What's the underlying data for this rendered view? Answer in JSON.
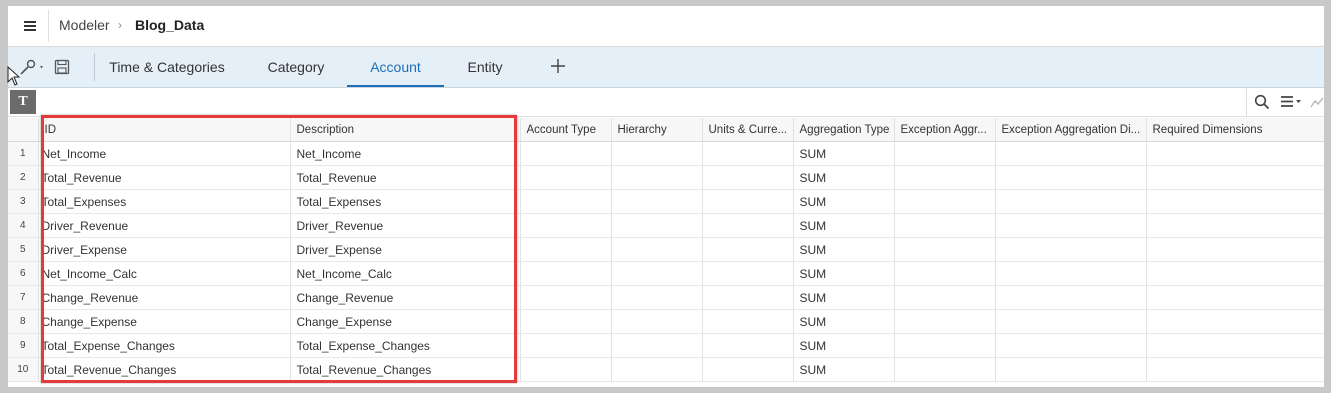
{
  "shell": {
    "breadcrumb_root": "Modeler",
    "breadcrumb_separator": "›",
    "breadcrumb_current": "Blog_Data"
  },
  "tabs": [
    {
      "label": "Time & Categories",
      "active": false
    },
    {
      "label": "Category",
      "active": false
    },
    {
      "label": "Account",
      "active": true
    },
    {
      "label": "Entity",
      "active": false
    }
  ],
  "toolbar": {
    "add_tab_label": "+",
    "text_format_label": "T",
    "icons": [
      "menu-icon",
      "wrench-icon",
      "save-icon",
      "search-icon",
      "list-options-icon"
    ]
  },
  "grid": {
    "columns": [
      "ID",
      "Description",
      "Account Type",
      "Hierarchy",
      "Units & Curre...",
      "Aggregation Type",
      "Exception Aggr...",
      "Exception Aggregation Di...",
      "Required Dimensions"
    ],
    "rows": [
      {
        "num": "1",
        "id": "Net_Income",
        "desc": "Net_Income",
        "agg": "SUM"
      },
      {
        "num": "2",
        "id": "Total_Revenue",
        "desc": "Total_Revenue",
        "agg": "SUM"
      },
      {
        "num": "3",
        "id": "Total_Expenses",
        "desc": "Total_Expenses",
        "agg": "SUM"
      },
      {
        "num": "4",
        "id": "Driver_Revenue",
        "desc": "Driver_Revenue",
        "agg": "SUM"
      },
      {
        "num": "5",
        "id": "Driver_Expense",
        "desc": "Driver_Expense",
        "agg": "SUM"
      },
      {
        "num": "6",
        "id": "Net_Income_Calc",
        "desc": "Net_Income_Calc",
        "agg": "SUM"
      },
      {
        "num": "7",
        "id": "Change_Revenue",
        "desc": "Change_Revenue",
        "agg": "SUM"
      },
      {
        "num": "8",
        "id": "Change_Expense",
        "desc": "Change_Expense",
        "agg": "SUM"
      },
      {
        "num": "9",
        "id": "Total_Expense_Changes",
        "desc": "Total_Expense_Changes",
        "agg": "SUM"
      },
      {
        "num": "10",
        "id": "Total_Revenue_Changes",
        "desc": "Total_Revenue_Changes",
        "agg": "SUM"
      }
    ]
  },
  "colors": {
    "accent": "#1f6fb5",
    "tabbar_bg": "#e4eff8",
    "highlight": "#e63939"
  }
}
